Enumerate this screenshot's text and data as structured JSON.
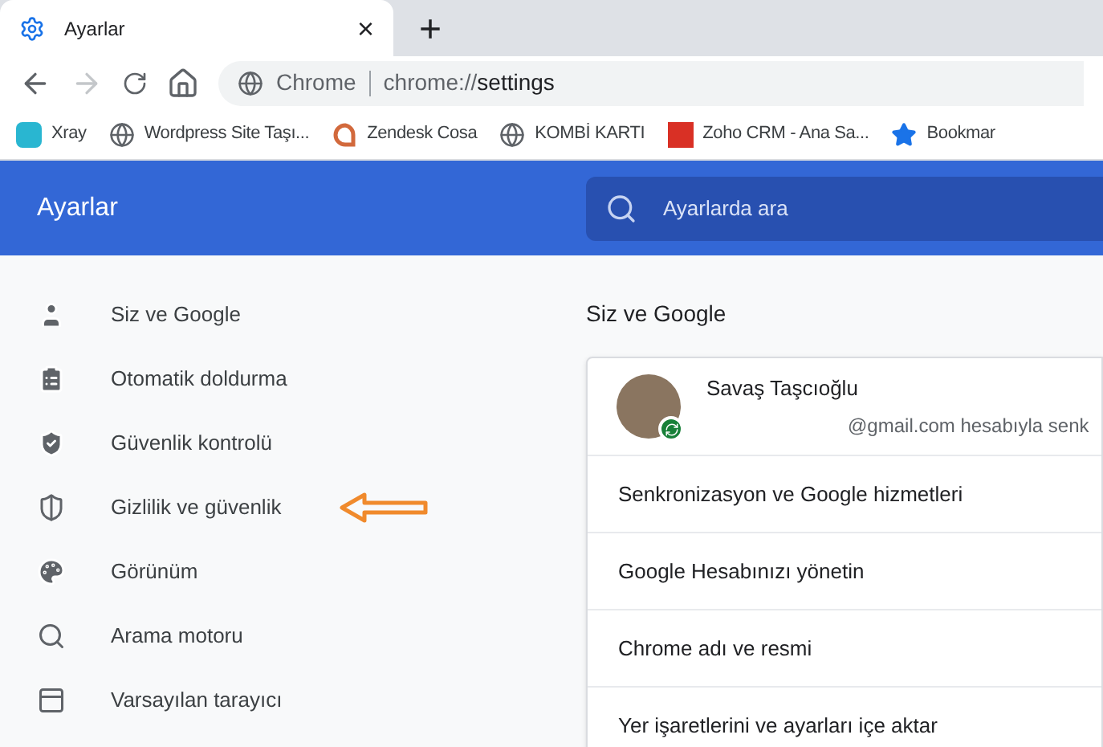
{
  "tab": {
    "title": "Ayarlar",
    "close": "×",
    "new_tab": "+"
  },
  "address_bar": {
    "site": "Chrome",
    "url_prefix": "chrome://",
    "url_path": "settings"
  },
  "bookmarks": [
    {
      "label": "Xray"
    },
    {
      "label": "Wordpress Site Taşı..."
    },
    {
      "label": "Zendesk Cosa"
    },
    {
      "label": "KOMBİ KARTI"
    },
    {
      "label": "Zoho CRM - Ana Sa..."
    },
    {
      "label": "Bookmar"
    }
  ],
  "header": {
    "title": "Ayarlar",
    "search_placeholder": "Ayarlarda ara"
  },
  "sidebar": {
    "items": [
      {
        "label": "Siz ve Google",
        "pointed": false
      },
      {
        "label": "Otomatik doldurma",
        "pointed": false
      },
      {
        "label": "Güvenlik kontrolü",
        "pointed": false
      },
      {
        "label": "Gizlilik ve güvenlik",
        "pointed": true
      },
      {
        "label": "Görünüm",
        "pointed": false
      },
      {
        "label": "Arama motoru",
        "pointed": false
      },
      {
        "label": "Varsayılan tarayıcı",
        "pointed": false
      }
    ]
  },
  "section": {
    "title": "Siz ve Google",
    "account": {
      "name": "Savaş Taşcıoğlu",
      "email": "@gmail.com hesabıyla senk"
    },
    "rows": [
      "Senkronizasyon ve Google hizmetleri",
      "Google Hesabınızı yönetin",
      "Chrome adı ve resmi",
      "Yer işaretlerini ve ayarları içe aktar"
    ]
  }
}
